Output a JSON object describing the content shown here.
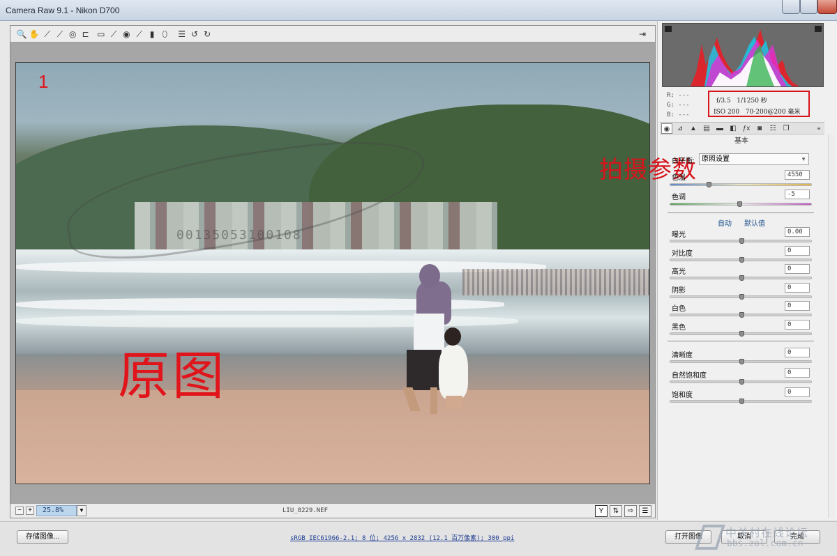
{
  "window": {
    "title": "Camera Raw 9.1 -  Nikon D700"
  },
  "toolbar": {
    "tools": [
      {
        "icon": "zoom-icon",
        "glyph": "🔍"
      },
      {
        "icon": "hand-icon",
        "glyph": "✋"
      },
      {
        "icon": "white-balance-icon",
        "glyph": "⟋"
      },
      {
        "icon": "color-sampler-icon",
        "glyph": "⟋"
      },
      {
        "icon": "target-adjust-icon",
        "glyph": "◎"
      },
      {
        "icon": "crop-icon",
        "glyph": "⊏"
      },
      {
        "icon": "straighten-icon",
        "glyph": "▭"
      },
      {
        "icon": "spot-removal-icon",
        "glyph": "⟋"
      },
      {
        "icon": "red-eye-icon",
        "glyph": "◉"
      },
      {
        "icon": "adjustment-brush-icon",
        "glyph": "⟋"
      },
      {
        "icon": "graduated-filter-icon",
        "glyph": "▮"
      },
      {
        "icon": "radial-filter-icon",
        "glyph": "⬯"
      },
      {
        "icon": "preferences-icon",
        "glyph": "☰"
      },
      {
        "icon": "rotate-left-icon",
        "glyph": "↺"
      },
      {
        "icon": "rotate-right-icon",
        "glyph": "↻"
      }
    ],
    "fullscreen_icon": "fullscreen-icon"
  },
  "preview": {
    "number_label": "1",
    "caption": "原图",
    "watermark_number": "00135053100108"
  },
  "status": {
    "zoom": "25.8%",
    "filename": "LIU_8229.NEF"
  },
  "histogram": {
    "rgb": {
      "r": "R:  ---",
      "g": "G:  ---",
      "b": "B:  ---"
    }
  },
  "exif": {
    "aperture": "f/3.5",
    "shutter": "1/1250 秒",
    "iso": "ISO 200",
    "lens": "70-200@200 毫米",
    "annotation": "拍摄参数"
  },
  "panel": {
    "section_title": "基本",
    "white_balance_label": "白平衡:",
    "white_balance_value": "原照设置",
    "temp_label": "色温",
    "temp_value": "4550",
    "temp_level": 0.26,
    "tint_label": "色调",
    "tint_value": "-5",
    "tint_level": 0.48,
    "auto_link": "自动",
    "default_link": "默认值",
    "sliders_a": [
      {
        "label": "曝光",
        "value": "0.00"
      },
      {
        "label": "对比度",
        "value": "0"
      },
      {
        "label": "高光",
        "value": "0"
      },
      {
        "label": "阴影",
        "value": "0"
      },
      {
        "label": "白色",
        "value": "0"
      },
      {
        "label": "黑色",
        "value": "0"
      }
    ],
    "sliders_b": [
      {
        "label": "清晰度",
        "value": "0"
      },
      {
        "label": "自然饱和度",
        "value": "0"
      },
      {
        "label": "饱和度",
        "value": "0"
      }
    ]
  },
  "footer": {
    "save_label": "存储图像...",
    "workflow_info": "sRGB IEC61966-2.1; 8 位; 4256 x 2832 (12.1 百万像素); 300 ppi",
    "open_label": "打开图像",
    "cancel_label": "取消",
    "done_label": "完成",
    "watermark_cn": "中关村在线论坛",
    "watermark_url": "bbs.zol.com.cn"
  },
  "colors": {
    "annotation_red": "#e0141a",
    "link_blue": "#1b4f8a"
  }
}
